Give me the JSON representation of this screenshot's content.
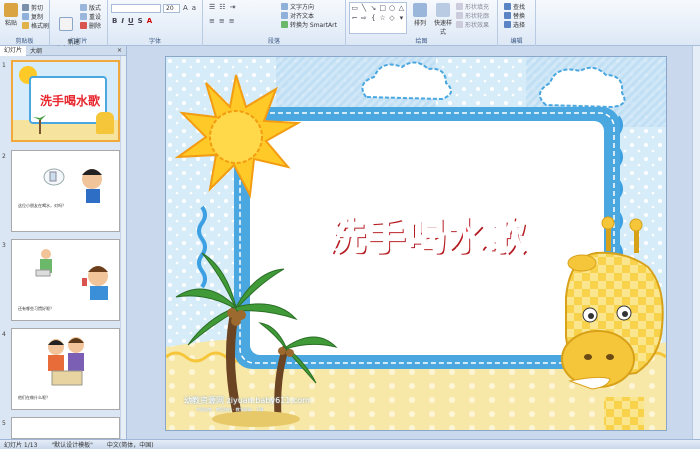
{
  "ribbon": {
    "clipboard": {
      "label": "剪贴板",
      "paste": "粘贴",
      "cut": "剪切",
      "copy": "复制",
      "format_painter": "格式刷"
    },
    "slides": {
      "label": "幻灯片",
      "new_slide": "新建\n幻灯片",
      "layout": "版式",
      "reset": "重设",
      "delete": "删除"
    },
    "font": {
      "label": "字体",
      "font_size": "20"
    },
    "paragraph": {
      "label": "段落",
      "text_direction": "文字方向",
      "align_text": "对齐文本",
      "smartart": "转换为 SmartArt"
    },
    "drawing": {
      "label": "绘图",
      "arrange": "排列",
      "quick_styles": "快速样式",
      "shape_fill": "形状填充",
      "shape_outline": "形状轮廓",
      "shape_effects": "形状效果"
    },
    "editing": {
      "label": "编辑",
      "find": "查找",
      "replace": "替换",
      "select": "选择"
    }
  },
  "pane": {
    "tab_slides": "幻灯片",
    "tab_outline": "大纲",
    "close": "×",
    "thumbs": [
      {
        "num": "1",
        "title": "洗手喝水歌"
      },
      {
        "num": "2",
        "caption": "这位小朋友在喝水，对吗？"
      },
      {
        "num": "3",
        "caption": "还有哪些习惯好呢？"
      },
      {
        "num": "4",
        "caption": "他们在做什么呢？"
      },
      {
        "num": "5"
      }
    ]
  },
  "slide": {
    "title": "洗手喝水歌",
    "watermark": "幼教资源网 ziyuan.baby611.com",
    "watermark_sub": "中国幼教 · 教案课件 · 教学资源 · 下载"
  },
  "status": {
    "slide_counter": "幻灯片 1/13",
    "theme": "\"默认设计模板\"",
    "language": "中文(简体，中国)"
  },
  "colors": {
    "title_red": "#e8262e",
    "frame_blue": "#4aa7e0",
    "sand": "#f7e7a7",
    "sun": "#ffc928",
    "giraffe": "#f6c63a"
  }
}
